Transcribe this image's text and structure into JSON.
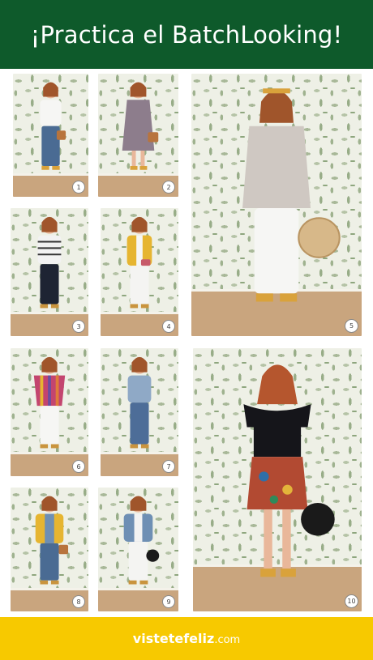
{
  "header": {
    "title": "¡Practica el BatchLooking!",
    "bg": "#0e5a2b"
  },
  "footer": {
    "brand": "vistetefeliz",
    "tld": ".com",
    "bg": "#f7c900"
  },
  "looks": [
    {
      "number": "1",
      "top": "#f6f6f4",
      "bottom": "#4a6b93",
      "accent": "#b8743d"
    },
    {
      "number": "2",
      "top": "#8d7d8c",
      "bottom": "#8d7d8c",
      "accent": "#b8743d"
    },
    {
      "number": "3",
      "top": "#f2f2f2",
      "bottom": "#1e2433",
      "accent": "#c9943e"
    },
    {
      "number": "4",
      "top": "#e6b531",
      "bottom": "#f4f4f2",
      "accent": "#c75a6a"
    },
    {
      "number": "5",
      "top": "#cfc8c2",
      "bottom": "#f6f6f4",
      "accent": "#d7b889"
    },
    {
      "number": "6",
      "top": "#c3456f",
      "bottom": "#f6f6f4",
      "accent": "#c9943e"
    },
    {
      "number": "7",
      "top": "#8fa9c6",
      "bottom": "#4d6d98",
      "accent": "#c9943e"
    },
    {
      "number": "8",
      "top": "#e6b531",
      "bottom": "#4a6b93",
      "accent": "#b8743d"
    },
    {
      "number": "9",
      "top": "#6e8fb4",
      "bottom": "#f4f4f2",
      "accent": "#1a1a1a"
    },
    {
      "number": "10",
      "top": "#15151a",
      "bottom": "#b24a32",
      "accent": "#1a1a1a"
    }
  ]
}
